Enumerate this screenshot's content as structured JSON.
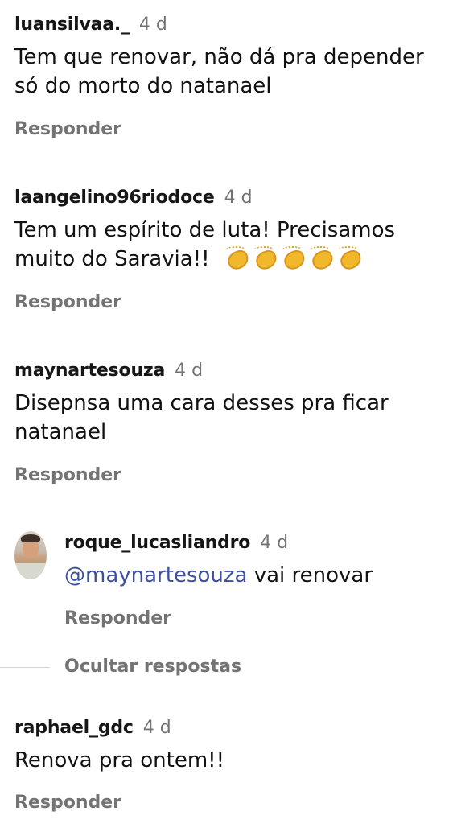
{
  "comments": [
    {
      "username": "luansilvaa._",
      "time": "4 d",
      "lines": [
        "Tem que renovar, não dá pra depender",
        "só do morto do natanael"
      ],
      "reply": "Responder"
    },
    {
      "username": "laangelino96riodoce",
      "time": "4 d",
      "lines": [
        "Tem um espírito de luta! Precisamos",
        "muito do Saravia!!"
      ],
      "emoji": "clapping-hands",
      "emoji_count": 5,
      "reply": "Responder"
    },
    {
      "username": "maynartesouza",
      "time": "4 d",
      "lines": [
        "Disepnsa uma cara desses pra ficar",
        "natanael"
      ],
      "reply": "Responder"
    },
    {
      "username": "roque_lucasliandro",
      "time": "4 d",
      "mention": "@maynartesouza",
      "text": " vai renovar",
      "reply": "Responder"
    },
    {
      "username": "raphael_gdc",
      "time": "4 d",
      "lines": [
        "Renova pra ontem!!"
      ],
      "reply": "Responder"
    }
  ],
  "hide_replies": "Ocultar respostas",
  "colors": {
    "text": "#141414",
    "muted": "#737373",
    "mention": "#3d4fa0"
  }
}
